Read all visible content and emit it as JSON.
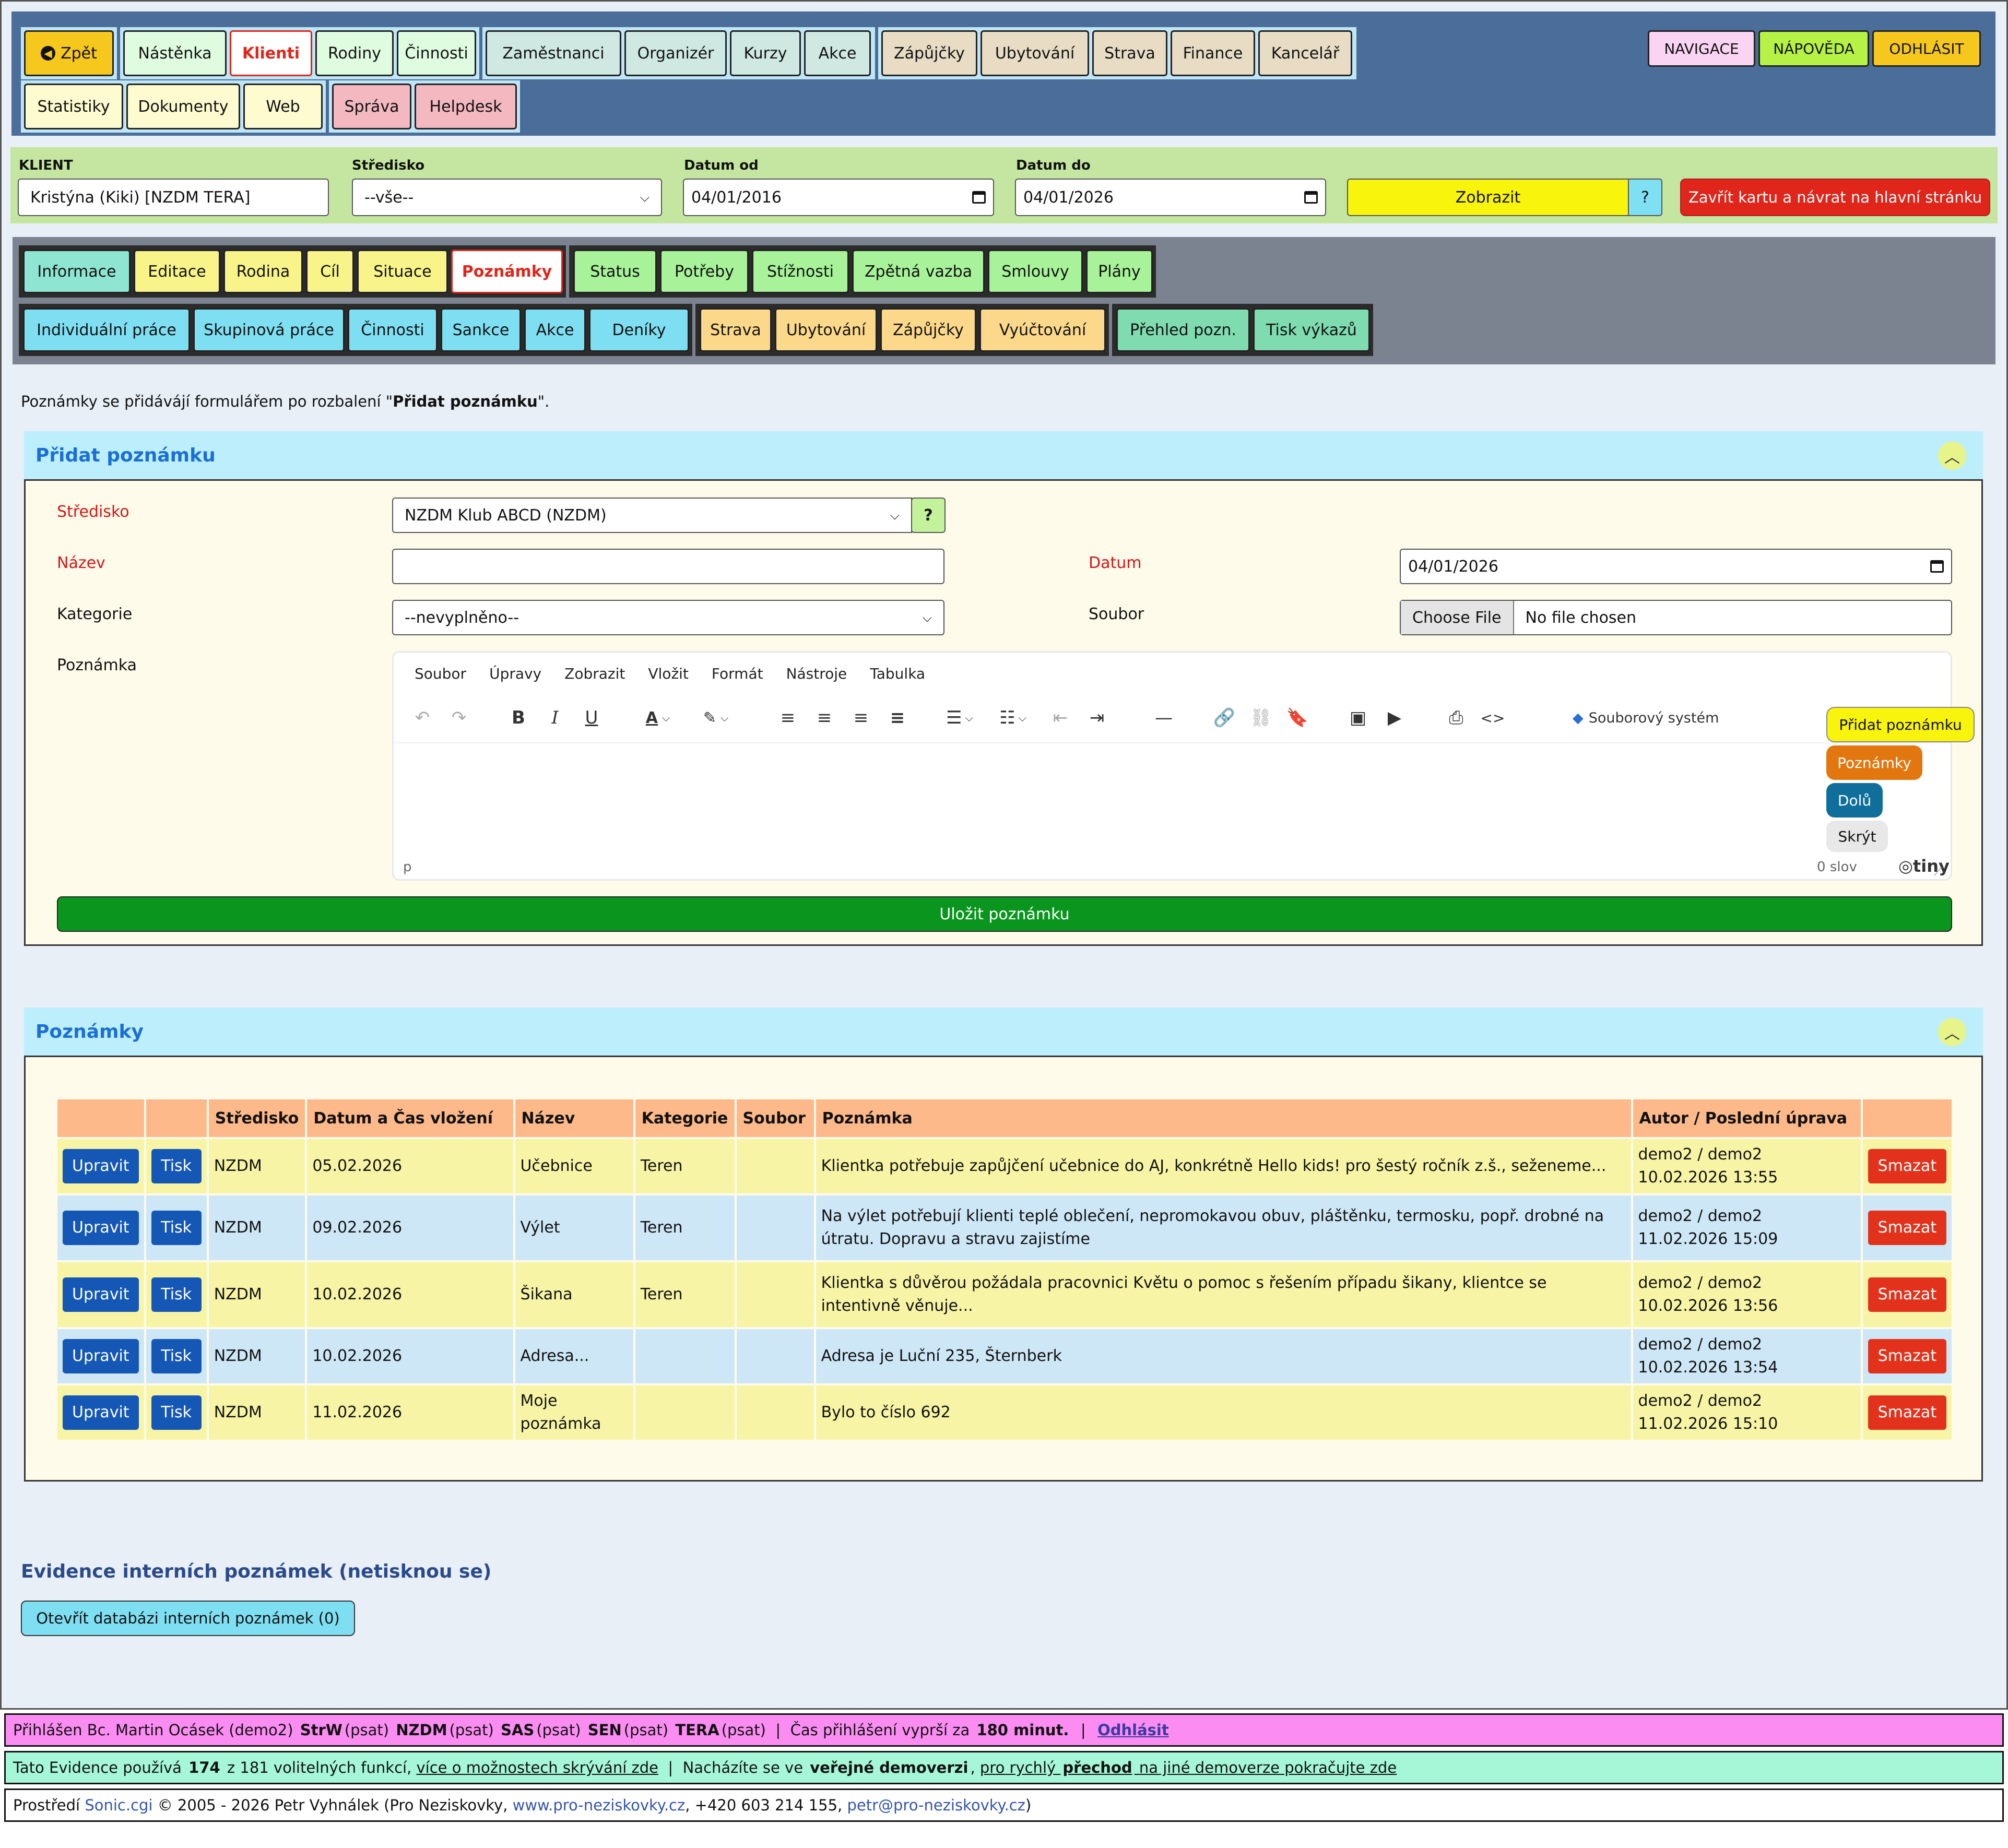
{
  "topnav": {
    "back": "Zpět",
    "group1": [
      "Nástěnka",
      "Klienti",
      "Rodiny",
      "Činnosti"
    ],
    "group2": [
      "Zaměstnanci",
      "Organizér",
      "Kurzy",
      "Akce"
    ],
    "group3": [
      "Zápůjčky",
      "Ubytování",
      "Strava",
      "Finance",
      "Kancelář"
    ],
    "group4": [
      "Statistiky",
      "Dokumenty",
      "Web"
    ],
    "group5": [
      "Správa",
      "Helpdesk"
    ],
    "navigace": "NAVIGACE",
    "napoveda": "NÁPOVĚDA",
    "odhlasit": "ODHLÁSIT"
  },
  "filter": {
    "klient_label": "KLIENT",
    "klient_value": "Kristýna (Kiki) [NZDM TERA]",
    "stredisko_label": "Středisko",
    "stredisko_value": "--vše--",
    "od_label": "Datum od",
    "od_value": "04/01/2016",
    "do_label": "Datum do",
    "do_value": "04/01/2026",
    "zobrazit": "Zobrazit",
    "help": "?",
    "zavrit": "Zavřít kartu a návrat na hlavní stránku"
  },
  "subnav": {
    "row1a": [
      "Informace",
      "Editace",
      "Rodina",
      "Cíl",
      "Situace",
      "Poznámky"
    ],
    "row1b": [
      "Status",
      "Potřeby",
      "Stížnosti",
      "Zpětná vazba",
      "Smlouvy",
      "Plány"
    ],
    "row2a": [
      "Individuální práce",
      "Skupinová práce",
      "Činnosti",
      "Sankce",
      "Akce",
      "Deníky"
    ],
    "row2b": [
      "Strava",
      "Ubytování",
      "Zápůjčky",
      "Vyúčtování"
    ],
    "row2c": [
      "Přehled pozn.",
      "Tisk výkazů"
    ]
  },
  "intro": {
    "text1": "Poznámky se přidávájí formulářem po rozbalení \"",
    "bold": "Přidat poznámku",
    "text2": "\"."
  },
  "form": {
    "title": "Přidat poznámku",
    "stredisko_label": "Středisko",
    "stredisko_value": "NZDM Klub ABCD (NZDM)",
    "help": "?",
    "nazev_label": "Název",
    "nazev_value": "",
    "datum_label": "Datum",
    "datum_value": "04/01/2026",
    "kategorie_label": "Kategorie",
    "kategorie_value": "--nevyplněno--",
    "soubor_label": "Soubor",
    "choose_file": "Choose File",
    "no_file": "No file chosen",
    "poznamka_label": "Poznámka",
    "editor_menu": [
      "Soubor",
      "Úpravy",
      "Zobrazit",
      "Vložit",
      "Formát",
      "Nástroje",
      "Tabulka"
    ],
    "souborovy_system": "Souborový systém",
    "status_path": "p",
    "word_count": "0 slov",
    "brand": "tiny",
    "save": "Uložit poznámku"
  },
  "side": {
    "pridat": "Přidat poznámku",
    "poznamky": "Poznámky",
    "dolu": "Dolů",
    "skryt": "Skrýt"
  },
  "notes": {
    "title": "Poznámky",
    "headers": [
      "",
      "",
      "Středisko",
      "Datum a Čas vložení",
      "Název",
      "Kategorie",
      "Soubor",
      "Poznámka",
      "Autor / Poslední úprava",
      ""
    ],
    "edit": "Upravit",
    "print": "Tisk",
    "delete": "Smazat",
    "rows": [
      {
        "stredisko": "NZDM",
        "datum": "05.02.2026",
        "nazev": "Učebnice",
        "kategorie": "Teren",
        "soubor": "",
        "poznamka": "Klientka potřebuje zapůjčení učebnice do AJ, konkrétně Hello kids! pro šestý ročník z.š., seženeme...",
        "autor": "demo2 / demo2 10.02.2026 13:55"
      },
      {
        "stredisko": "NZDM",
        "datum": "09.02.2026",
        "nazev": "Výlet",
        "kategorie": "Teren",
        "soubor": "",
        "poznamka": "Na výlet potřebují klienti teplé oblečení, nepromokavou obuv, pláštěnku, termosku, popř. drobné na útratu. Dopravu a stravu zajistíme",
        "autor": "demo2 / demo2 11.02.2026 15:09"
      },
      {
        "stredisko": "NZDM",
        "datum": "10.02.2026",
        "nazev": "Šikana",
        "kategorie": "Teren",
        "soubor": "",
        "poznamka": "Klientka s důvěrou požádala pracovnici Květu o pomoc s řešením případu šikany, klientce se intentivně věnuje...",
        "autor": "demo2 / demo2 10.02.2026 13:56"
      },
      {
        "stredisko": "NZDM",
        "datum": "10.02.2026",
        "nazev": "Adresa...",
        "kategorie": "",
        "soubor": "",
        "poznamka": "Adresa je Luční 235, Šternberk",
        "autor": "demo2 / demo2 10.02.2026 13:54"
      },
      {
        "stredisko": "NZDM",
        "datum": "11.02.2026",
        "nazev": "Moje poznámka",
        "kategorie": "",
        "soubor": "",
        "poznamka": "Bylo to číslo 692",
        "autor": "demo2 / demo2 11.02.2026 15:10"
      }
    ]
  },
  "internal": {
    "title": "Evidence interních poznámek (netisknou se)",
    "button": "Otevřít databázi interních poznámek  (0)"
  },
  "footer": {
    "l1_a": "Přihlášen Bc. Martin Ocásek (demo2)",
    "l1_strw": "StrW",
    "l1_p1": "(psat)",
    "l1_nzdm": "NZDM",
    "l1_p2": "(psat)",
    "l1_sas": "SAS",
    "l1_p3": "(psat)",
    "l1_sen": "SEN",
    "l1_p4": "(psat)",
    "l1_tera": "TERA",
    "l1_p5": "(psat)",
    "l1_sep": "|",
    "l1_cas": "Čas přihlášení vyprší za",
    "l1_min": "180 minut.",
    "l1_sep2": "|",
    "l1_odhlasit": "Odhlásit",
    "l2_a": "Tato Evidence používá",
    "l2_n": "174",
    "l2_b": "z 181 volitelných funkcí,",
    "l2_link1": "více o možnostech skrývání zde",
    "l2_sep": "|",
    "l2_c": "Nacházíte se ve",
    "l2_d": "veřejné demoverzi",
    "l2_comma": ",",
    "l2_link2a": "pro rychlý",
    "l2_link2b": "přechod",
    "l2_link2c": "na jiné demoverze pokračujte zde",
    "l3_a": "Prostředí",
    "l3_sonic": "Sonic.cgi",
    "l3_b": "© 2005 - 2026 Petr Vyhnálek (Pro Neziskovky,",
    "l3_web": "www.pro-neziskovky.cz",
    "l3_c": ", +420 603 214 155,",
    "l3_mail": "petr@pro-neziskovky.cz",
    "l3_d": ")"
  },
  "colors": {
    "nav_bg": "#4a6e99",
    "filter_bg": "#c4e6a0",
    "subnav_bg": "#7b8390",
    "panel_header": "#bdeefc",
    "active_red": "#e0251b",
    "save_green": "#0a961e",
    "delete_red": "#e2321b",
    "edit_blue": "#1557b5"
  }
}
